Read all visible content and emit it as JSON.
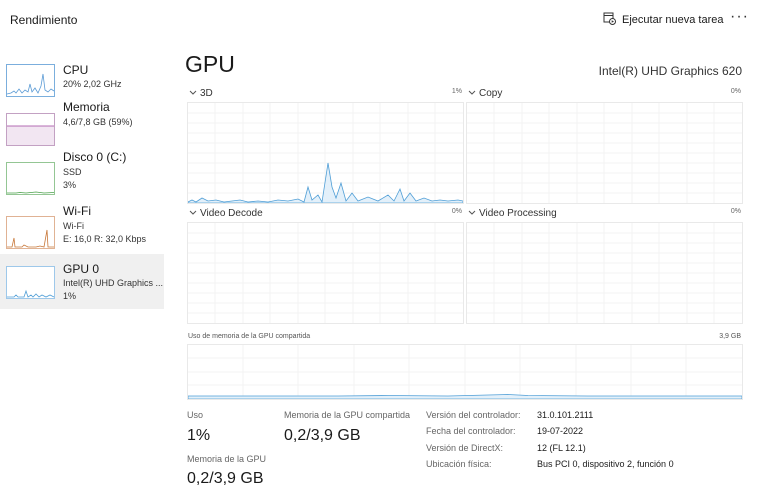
{
  "header": {
    "title": "Rendimiento",
    "run_task_label": "Ejecutar nueva tarea",
    "more_label": "···"
  },
  "sidebar": {
    "items": [
      {
        "name": "CPU",
        "line1": "20%  2,02 GHz",
        "line2": "",
        "line3": ""
      },
      {
        "name": "Memoria",
        "line1": "4,6/7,8 GB (59%)",
        "line2": "",
        "line3": ""
      },
      {
        "name": "Disco 0 (C:)",
        "line1": "SSD",
        "line2": "3%",
        "line3": ""
      },
      {
        "name": "Wi-Fi",
        "line1": "Wi-Fi",
        "line2": "E: 16,0  R: 32,0 Kbps",
        "line3": ""
      },
      {
        "name": "GPU 0",
        "line1": "Intel(R) UHD Graphics ...",
        "line2": "1%",
        "line3": ""
      }
    ]
  },
  "main": {
    "title": "GPU",
    "model": "Intel(R) UHD Graphics 620",
    "panels": [
      {
        "label": "3D",
        "pct": "1%"
      },
      {
        "label": "Copy",
        "pct": "0%"
      },
      {
        "label": "Video Decode",
        "pct": "0%"
      },
      {
        "label": "Video Processing",
        "pct": "0%"
      }
    ],
    "shared_memory_graph": {
      "label": "Uso de memoria de la GPU compartida",
      "max": "3,9 GB"
    },
    "stats": {
      "usage_label": "Uso",
      "usage_value": "1%",
      "shared_label": "Memoria de la GPU compartida",
      "shared_value": "0,2/3,9 GB",
      "gpu_mem_label": "Memoria de la GPU",
      "gpu_mem_value": "0,2/3,9 GB"
    },
    "info": [
      {
        "label": "Versión del controlador:",
        "value": "31.0.101.2111"
      },
      {
        "label": "Fecha del controlador:",
        "value": "19-07-2022"
      },
      {
        "label": "Versión de DirectX:",
        "value": "12 (FL 12.1)"
      },
      {
        "label": "Ubicación física:",
        "value": "Bus PCI 0, dispositivo 2, función 0"
      }
    ]
  },
  "colors": {
    "cpu": "#5b9bd5",
    "memory": "#9b3f9b",
    "disk": "#4aa14a",
    "wifi": "#c8783a",
    "gpu": "#4f9ed6",
    "graph_border": "#e9e9e9",
    "grid": "#f3f3f3"
  },
  "icons": [
    "run-task-icon",
    "more-options-icon",
    "chevron-down-icon"
  ]
}
